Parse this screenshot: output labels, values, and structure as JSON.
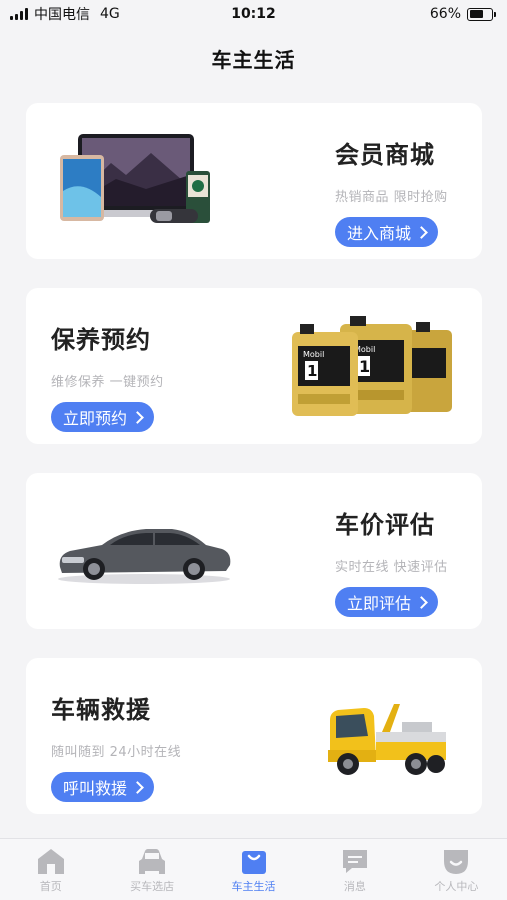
{
  "status": {
    "carrier": "中国电信",
    "network": "4G",
    "time": "10:12",
    "battery": "66%",
    "battery_level": 0.66
  },
  "header": {
    "title": "车主生活"
  },
  "cards": [
    {
      "title": "会员商城",
      "subtitle": "热销商品 限时抢购",
      "button": "进入商城"
    },
    {
      "title": "保养预约",
      "subtitle": "维修保养 一键预约",
      "button": "立即预约",
      "oil_label": "Mobil",
      "oil_num": "1"
    },
    {
      "title": "车价评估",
      "subtitle": "实时在线 快速评估",
      "button": "立即评估"
    },
    {
      "title": "车辆救援",
      "subtitle": "随叫随到 24小时在线",
      "button": "呼叫救援"
    }
  ],
  "tabbar": [
    {
      "label": "首页",
      "icon": "home-icon",
      "active": false
    },
    {
      "label": "买车选店",
      "icon": "car-icon",
      "active": false
    },
    {
      "label": "车主生活",
      "icon": "bag-icon",
      "active": true
    },
    {
      "label": "消息",
      "icon": "message-icon",
      "active": false
    },
    {
      "label": "个人中心",
      "icon": "user-icon",
      "active": false
    }
  ],
  "colors": {
    "accent": "#4f7ff2",
    "inactive": "#b8b8bc",
    "background": "#f4f4f6"
  }
}
